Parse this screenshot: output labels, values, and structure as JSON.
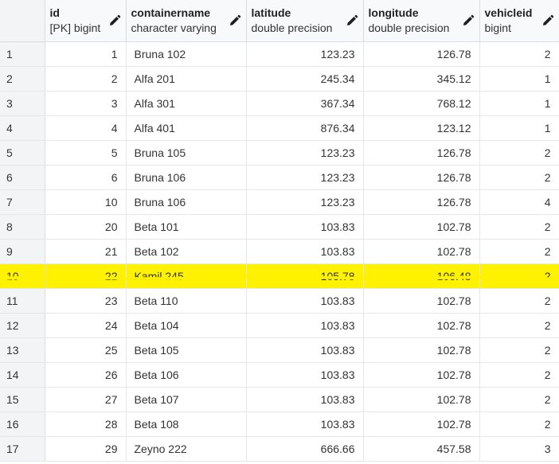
{
  "columns": [
    {
      "key": "id",
      "name": "id",
      "type": "[PK] bigint",
      "align": "num",
      "editable": true
    },
    {
      "key": "containername",
      "name": "containername",
      "type": "character varying",
      "align": "txt",
      "editable": true
    },
    {
      "key": "latitude",
      "name": "latitude",
      "type": "double precision",
      "align": "num",
      "editable": true
    },
    {
      "key": "longitude",
      "name": "longitude",
      "type": "double precision",
      "align": "num",
      "editable": true
    },
    {
      "key": "vehicleid",
      "name": "vehicleid",
      "type": "bigint",
      "align": "num",
      "editable": true
    }
  ],
  "rows": [
    {
      "n": "1",
      "id": "1",
      "containername": "Bruna 102",
      "latitude": "123.23",
      "longitude": "126.78",
      "vehicleid": "2"
    },
    {
      "n": "2",
      "id": "2",
      "containername": "Alfa 201",
      "latitude": "245.34",
      "longitude": "345.12",
      "vehicleid": "1"
    },
    {
      "n": "3",
      "id": "3",
      "containername": "Alfa 301",
      "latitude": "367.34",
      "longitude": "768.12",
      "vehicleid": "1"
    },
    {
      "n": "4",
      "id": "4",
      "containername": "Alfa 401",
      "latitude": "876.34",
      "longitude": "123.12",
      "vehicleid": "1"
    },
    {
      "n": "5",
      "id": "5",
      "containername": "Bruna 105",
      "latitude": "123.23",
      "longitude": "126.78",
      "vehicleid": "2"
    },
    {
      "n": "6",
      "id": "6",
      "containername": "Bruna 106",
      "latitude": "123.23",
      "longitude": "126.78",
      "vehicleid": "2"
    },
    {
      "n": "7",
      "id": "10",
      "containername": "Bruna 106",
      "latitude": "123.23",
      "longitude": "126.78",
      "vehicleid": "4"
    },
    {
      "n": "8",
      "id": "20",
      "containername": "Beta 101",
      "latitude": "103.83",
      "longitude": "102.78",
      "vehicleid": "2"
    },
    {
      "n": "9",
      "id": "21",
      "containername": "Beta 102",
      "latitude": "103.83",
      "longitude": "102.78",
      "vehicleid": "2"
    },
    {
      "n": "10",
      "id": "22",
      "containername": "Kamil 245",
      "latitude": "105.78",
      "longitude": "106.48",
      "vehicleid": "2",
      "highlight": true
    },
    {
      "n": "11",
      "id": "23",
      "containername": "Beta 110",
      "latitude": "103.83",
      "longitude": "102.78",
      "vehicleid": "2"
    },
    {
      "n": "12",
      "id": "24",
      "containername": "Beta 104",
      "latitude": "103.83",
      "longitude": "102.78",
      "vehicleid": "2"
    },
    {
      "n": "13",
      "id": "25",
      "containername": "Beta 105",
      "latitude": "103.83",
      "longitude": "102.78",
      "vehicleid": "2"
    },
    {
      "n": "14",
      "id": "26",
      "containername": "Beta 106",
      "latitude": "103.83",
      "longitude": "102.78",
      "vehicleid": "2"
    },
    {
      "n": "15",
      "id": "27",
      "containername": "Beta 107",
      "latitude": "103.83",
      "longitude": "102.78",
      "vehicleid": "2"
    },
    {
      "n": "16",
      "id": "28",
      "containername": "Beta 108",
      "latitude": "103.83",
      "longitude": "102.78",
      "vehicleid": "2"
    },
    {
      "n": "17",
      "id": "29",
      "containername": "Zeyno 222",
      "latitude": "666.66",
      "longitude": "457.58",
      "vehicleid": "3"
    }
  ],
  "icons": {
    "edit": "pencil-icon"
  },
  "colors": {
    "highlight": "#fff200",
    "header_bg": "#f8f9fa",
    "row_number_bg": "#f3f4f6",
    "grid_line": "#e4e6e9"
  }
}
